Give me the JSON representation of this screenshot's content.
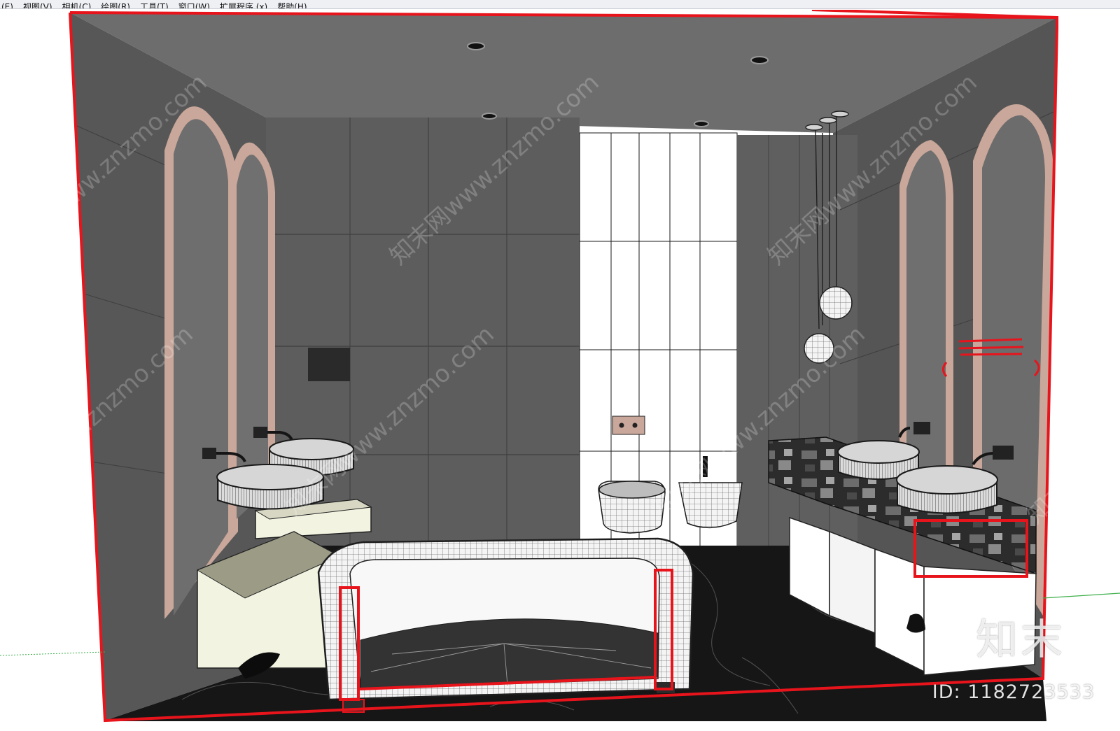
{
  "menubar": {
    "items": [
      "(E)",
      "视图(V)",
      "相机(C)",
      "绘图(R)",
      "工具(T)",
      "窗口(W)",
      "扩展程序 (x)",
      "帮助(H)"
    ]
  },
  "watermark": {
    "url_text": "知末网www.znzmo.com",
    "brand": "知末",
    "id_text": "ID: 1182723533"
  },
  "colors": {
    "selection": "#e8141c",
    "ceiling": "#6d6d6d",
    "side_wall": "#555555",
    "back_wall": "#5e5e5e",
    "tile_white": "#ffffff",
    "floor": "#141414",
    "cabinet_cream": "#f3f3e2",
    "mirror_frame": "#c9a79a"
  },
  "icons": {
    "sink": "vessel-sink-icon",
    "pendant": "pendant-lamp-icon",
    "towel": "towel-rail-icon"
  }
}
